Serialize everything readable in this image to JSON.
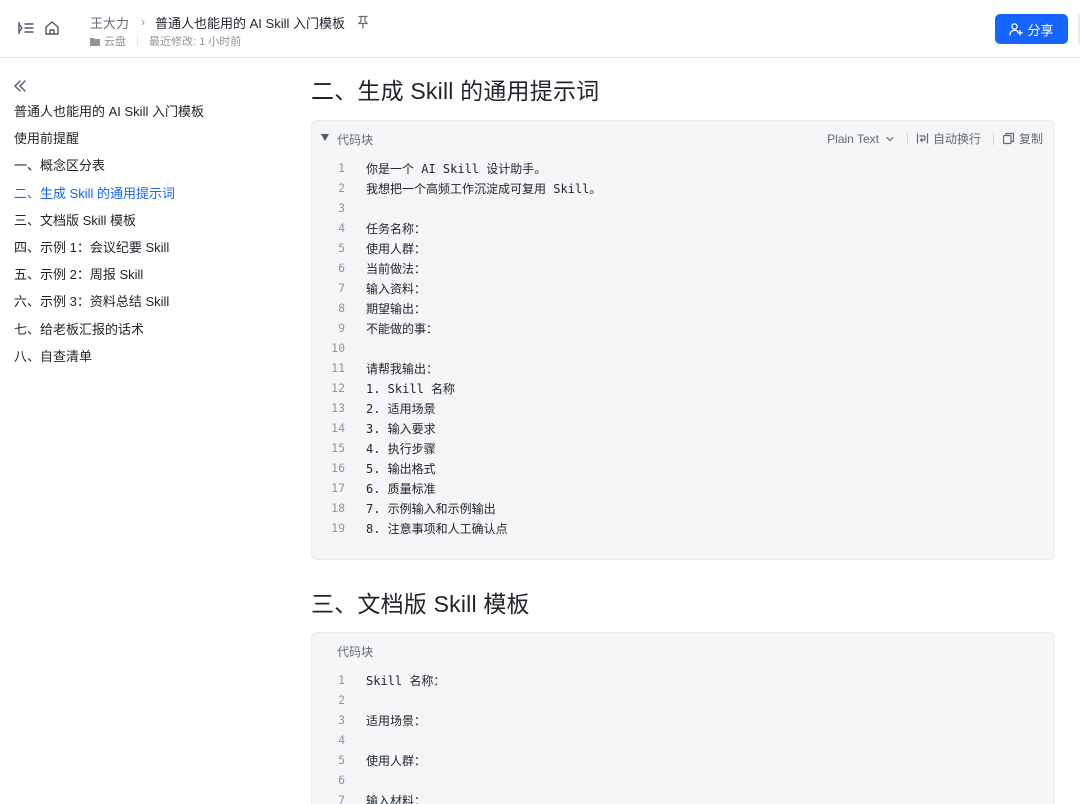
{
  "header": {
    "owner": "王大力",
    "breadcrumb_sep": "›",
    "doc_title": "普通人也能用的 AI Skill 入门模板",
    "location": "云盘",
    "last_modified": "最近修改: 1 小时前",
    "share_label": "分享"
  },
  "toc": {
    "items": [
      {
        "label": "普通人也能用的 AI Skill 入门模板"
      },
      {
        "label": "使用前提醒"
      },
      {
        "label": "一、概念区分表"
      },
      {
        "label": "二、生成 Skill 的通用提示词"
      },
      {
        "label": "三、文档版 Skill 模板"
      },
      {
        "label": "四、示例 1：会议纪要 Skill"
      },
      {
        "label": "五、示例 2：周报 Skill"
      },
      {
        "label": "六、示例 3：资料总结 Skill"
      },
      {
        "label": "七、给老板汇报的话术"
      },
      {
        "label": "八、自查清单"
      }
    ],
    "active_index": 3
  },
  "sections": [
    {
      "heading": "二、生成 Skill 的通用提示词",
      "code_label": "代码块",
      "language": "Plain Text",
      "wrap_label": "自动换行",
      "copy_label": "复制",
      "lines": [
        {
          "n": "1",
          "text": "你是一个 AI Skill 设计助手。"
        },
        {
          "n": "2",
          "text": "我想把一个高频工作沉淀成可复用 Skill。"
        },
        {
          "n": "3",
          "text": ""
        },
        {
          "n": "4",
          "text": "任务名称："
        },
        {
          "n": "5",
          "text": "使用人群："
        },
        {
          "n": "6",
          "text": "当前做法："
        },
        {
          "n": "7",
          "text": "输入资料："
        },
        {
          "n": "8",
          "text": "期望输出："
        },
        {
          "n": "9",
          "text": "不能做的事："
        },
        {
          "n": "10",
          "text": ""
        },
        {
          "n": "11",
          "text": "请帮我输出："
        },
        {
          "n": "12",
          "text": "1. Skill 名称"
        },
        {
          "n": "13",
          "text": "2. 适用场景"
        },
        {
          "n": "14",
          "text": "3. 输入要求"
        },
        {
          "n": "15",
          "text": "4. 执行步骤"
        },
        {
          "n": "16",
          "text": "5. 输出格式"
        },
        {
          "n": "17",
          "text": "6. 质量标准"
        },
        {
          "n": "18",
          "text": "7. 示例输入和示例输出"
        },
        {
          "n": "19",
          "text": "8. 注意事项和人工确认点"
        }
      ]
    },
    {
      "heading": "三、文档版 Skill 模板",
      "code_label": "代码块",
      "lines": [
        {
          "n": "1",
          "text": "Skill 名称："
        },
        {
          "n": "2",
          "text": ""
        },
        {
          "n": "3",
          "text": "适用场景："
        },
        {
          "n": "4",
          "text": ""
        },
        {
          "n": "5",
          "text": "使用人群："
        },
        {
          "n": "6",
          "text": ""
        },
        {
          "n": "7",
          "text": "输入材料："
        }
      ]
    }
  ],
  "icons": {
    "sidebar_toggle": "outline-toggle-icon",
    "home": "home-icon",
    "pin": "pin-icon",
    "folder": "folder-icon",
    "share": "user-add-icon",
    "collapse": "double-chevron-left-icon",
    "expand": "triangle-down-icon",
    "dropdown": "chevron-down-icon",
    "wrap": "wrap-text-icon",
    "copy": "copy-icon"
  },
  "colors": {
    "accent": "#1664ff",
    "text": "#1f2329",
    "muted": "#646a73",
    "code_bg": "#f5f6f7"
  }
}
